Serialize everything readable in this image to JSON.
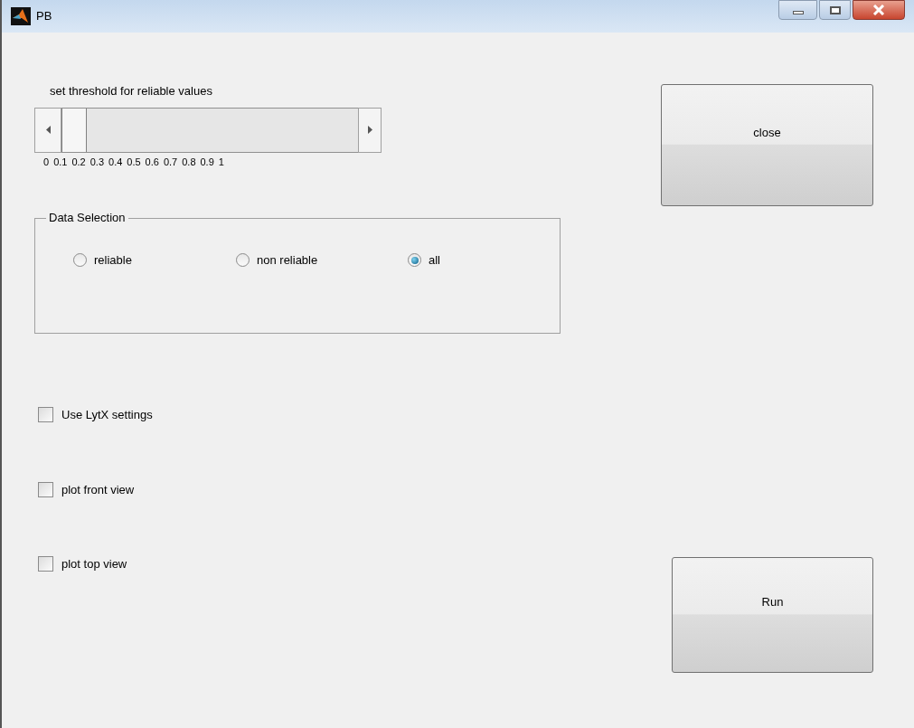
{
  "window": {
    "title": "PB"
  },
  "slider": {
    "label": "set threshold for reliable values",
    "level": 0,
    "ticks": [
      "0",
      "0.1",
      "0.2",
      "0.3",
      "0.4",
      "0.5",
      "0.6",
      "0.7",
      "0.8",
      "0.9",
      "1"
    ]
  },
  "data_selection": {
    "title": "Data Selection",
    "options": [
      {
        "label": "reliable",
        "selected": false
      },
      {
        "label": "non reliable",
        "selected": false
      },
      {
        "label": "all",
        "selected": true
      }
    ]
  },
  "checkboxes": [
    {
      "label": "Use LytX settings",
      "checked": false
    },
    {
      "label": "plot front view",
      "checked": false
    },
    {
      "label": "plot top view",
      "checked": false
    }
  ],
  "buttons": {
    "close": "close",
    "run": "Run"
  }
}
